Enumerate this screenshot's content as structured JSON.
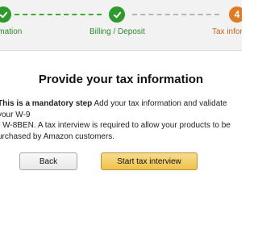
{
  "stepper": {
    "steps": [
      {
        "label": "rmation",
        "status": "done"
      },
      {
        "label": "Billing / Deposit",
        "status": "done"
      },
      {
        "number": "4",
        "label": "Tax inform",
        "status": "current"
      }
    ],
    "colors": {
      "done": "#2f9a2c",
      "current": "#e07b24"
    }
  },
  "main": {
    "title": "Provide your tax information",
    "mandatory_lead": "This is a mandatory step",
    "description_line1": " Add your tax information and validate your W-9",
    "description_line2": "r W-8BEN. A tax interview is required to allow your products to be",
    "description_line3": "urchased by Amazon customers."
  },
  "actions": {
    "back_label": "Back",
    "start_label": "Start tax interview",
    "primary_color": "#f0c14b"
  }
}
